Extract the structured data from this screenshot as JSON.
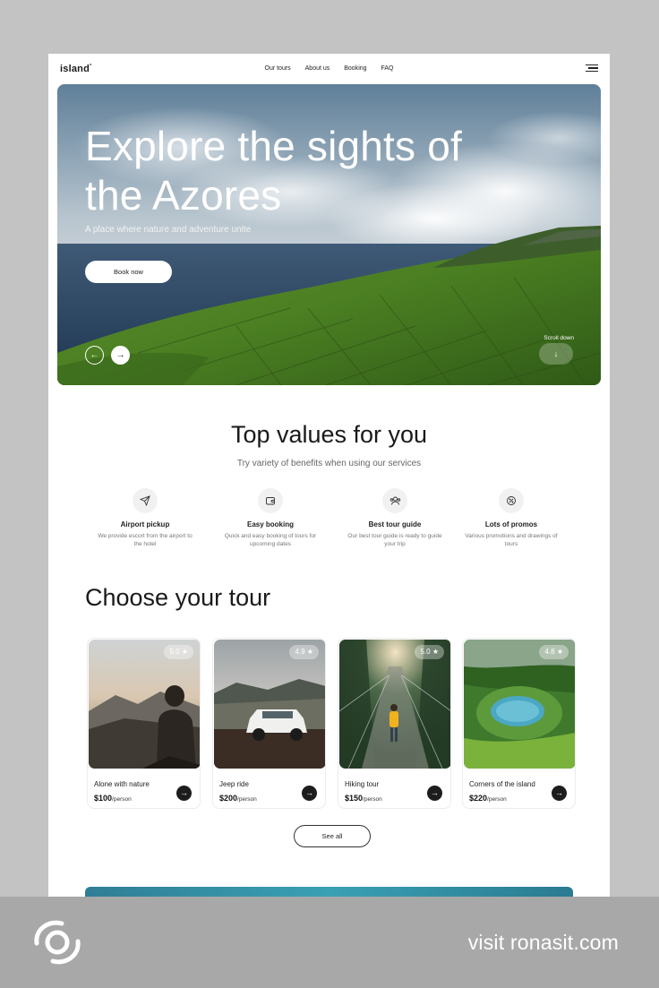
{
  "header": {
    "logo": "island",
    "logo_mark": "°",
    "nav": [
      "Our tours",
      "About us",
      "Booking",
      "FAQ"
    ]
  },
  "hero": {
    "title": "Explore the sights of the Azores",
    "subtitle": "A place where nature and adventure unite",
    "book_label": "Book now",
    "scroll_label": "Scroll down"
  },
  "values": {
    "title": "Top values for you",
    "subtitle": "Try variety of benefits when using our services",
    "items": [
      {
        "title": "Airport pickup",
        "desc": "We provide escort from the airport to the hotel",
        "icon": "paper-plane-icon"
      },
      {
        "title": "Easy booking",
        "desc": "Quick and easy booking of tours for upcoming dates",
        "icon": "wallet-icon"
      },
      {
        "title": "Best tour guide",
        "desc": "Our best tour guide is ready to guide your trip",
        "icon": "users-icon"
      },
      {
        "title": "Lots of promos",
        "desc": "Various promotions and drawings of tours",
        "icon": "percent-badge-icon"
      }
    ]
  },
  "tours": {
    "title": "Choose your tour",
    "per_label": "person",
    "see_all_label": "See all",
    "items": [
      {
        "name": "Alone with nature",
        "price": "$100",
        "rating": "5.0"
      },
      {
        "name": "Jeep ride",
        "price": "$200",
        "rating": "4.9"
      },
      {
        "name": "Hiking tour",
        "price": "$150",
        "rating": "5.0"
      },
      {
        "name": "Corners of the island",
        "price": "$220",
        "rating": "4.8"
      }
    ]
  },
  "footer": {
    "visit_text": "visit ronasit.com"
  },
  "colors": {
    "accent_dark": "#1d1d1d",
    "page_bg": "#ffffff",
    "frame_bg": "#c3c3c3"
  }
}
